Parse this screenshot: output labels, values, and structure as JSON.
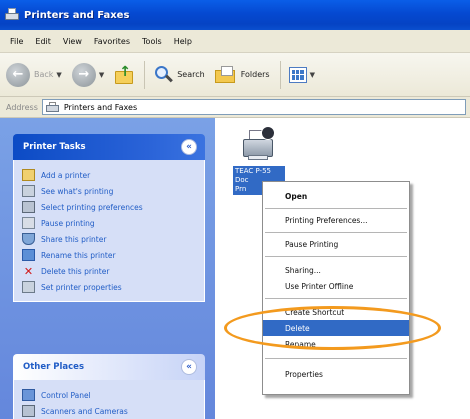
{
  "window": {
    "title": "Printers and Faxes"
  },
  "menubar": {
    "items": [
      "File",
      "Edit",
      "View",
      "Favorites",
      "Tools",
      "Help"
    ]
  },
  "toolbar": {
    "back_label": "Back",
    "search_label": "Search",
    "folders_label": "Folders"
  },
  "address": {
    "label": "Address",
    "value": "Printers and Faxes"
  },
  "printer_tasks": {
    "title": "Printer Tasks",
    "items": [
      {
        "label": "Add a printer",
        "icon": "add-printer-icon"
      },
      {
        "label": "See what's printing",
        "icon": "print-queue-icon"
      },
      {
        "label": "Select printing preferences",
        "icon": "preferences-icon"
      },
      {
        "label": "Pause printing",
        "icon": "pause-icon"
      },
      {
        "label": "Share this printer",
        "icon": "share-icon"
      },
      {
        "label": "Rename this printer",
        "icon": "rename-icon"
      },
      {
        "label": "Delete this printer",
        "icon": "delete-x-icon"
      },
      {
        "label": "Set printer properties",
        "icon": "properties-icon"
      }
    ]
  },
  "other_places": {
    "title": "Other Places",
    "items": [
      {
        "label": "Control Panel",
        "icon": "control-panel-icon"
      },
      {
        "label": "Scanners and Cameras",
        "icon": "scanner-icon"
      }
    ]
  },
  "printer": {
    "label_line1": "TEAC P-55",
    "label_line2": "Doc",
    "label_line3": "Prn"
  },
  "context_menu": {
    "items": [
      {
        "label": "Open",
        "style": "bold"
      },
      {
        "label": "Printing Preferences...",
        "style": "normal"
      },
      {
        "label": "Pause Printing",
        "style": "normal"
      },
      {
        "label": "Sharing...",
        "style": "normal"
      },
      {
        "label": "Use Printer Offline",
        "style": "normal"
      },
      {
        "label": "Create Shortcut",
        "style": "normal"
      },
      {
        "label": "Delete",
        "style": "highlighted"
      },
      {
        "label": "Rename",
        "style": "normal"
      },
      {
        "label": "Properties",
        "style": "normal"
      }
    ]
  },
  "colors": {
    "highlight_ring": "#f39a1e",
    "selection": "#316ac5"
  }
}
